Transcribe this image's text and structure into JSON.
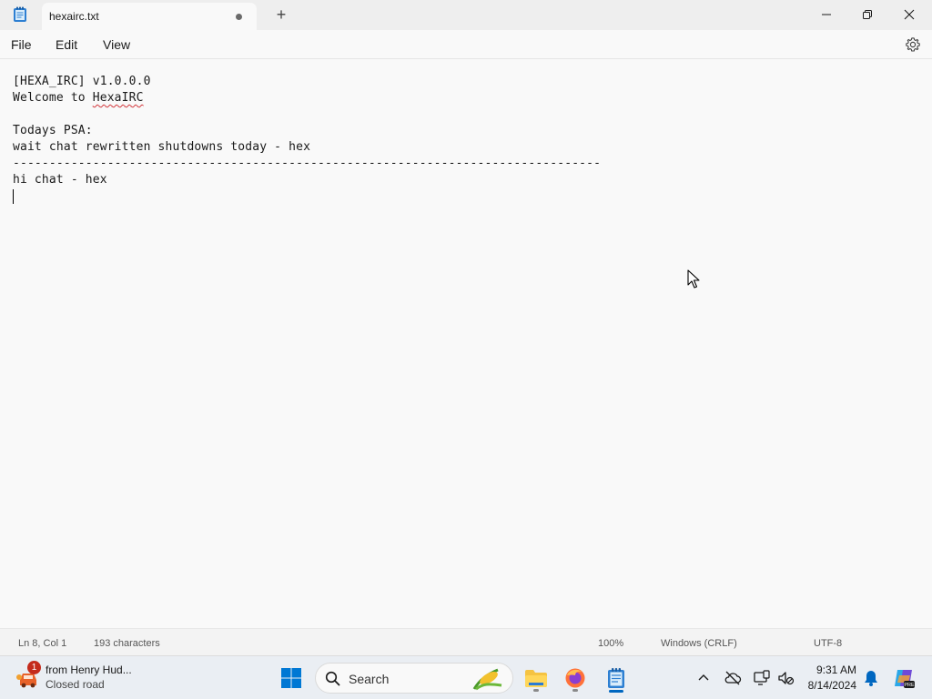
{
  "window": {
    "tab_title": "hexairc.txt",
    "new_tab_glyph": "+"
  },
  "menu": {
    "items": [
      "File",
      "Edit",
      "View"
    ]
  },
  "editor": {
    "lines": [
      "[HEXA_IRC] v1.0.0.0",
      "Welcome to ",
      "HexaIRC",
      "",
      "Todays PSA:",
      "wait chat rewritten shutdowns today - hex",
      "---------------------------------------------------------------------------------",
      "hi chat - hex"
    ]
  },
  "status": {
    "position": "Ln 8, Col 1",
    "characters": "193 characters",
    "zoom": "100%",
    "line_ending": "Windows (CRLF)",
    "encoding": "UTF-8"
  },
  "taskbar": {
    "weather_title": "from Henry Hud...",
    "weather_subtitle": "Closed road",
    "badge_count": "1",
    "search_label": "Search",
    "time": "9:31 AM",
    "date": "8/14/2024"
  },
  "colors": {
    "accent": "#0067c0",
    "badge": "#c42b1c",
    "spellcheck": "#d13438"
  }
}
